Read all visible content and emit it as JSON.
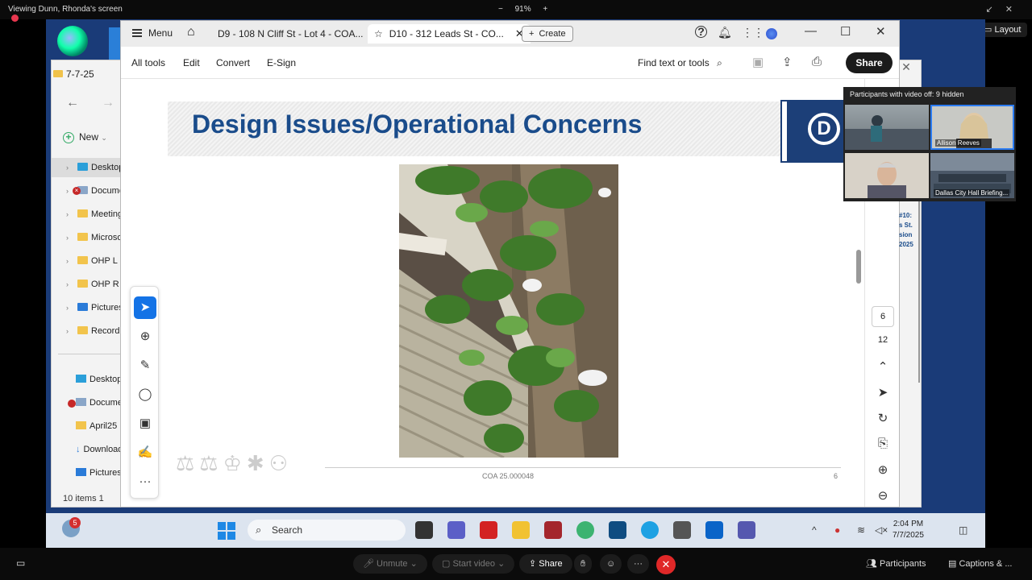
{
  "zoom": {
    "viewing": "Viewing Dunn, Rhonda's screen",
    "zoom_level": "91%",
    "minus": "−",
    "plus": "+",
    "layout": "Layout",
    "participants_label": "Participants with video off: 9 hidden",
    "tiles": [
      {
        "name": ""
      },
      {
        "name": "Allison Reeves"
      },
      {
        "name": ""
      },
      {
        "name": "Dallas City Hall    Briefing..."
      }
    ],
    "bottom": {
      "unmute": "Unmute",
      "start_video": "Start video",
      "share": "Share",
      "participants": "Participants",
      "captions": "Captions & ..."
    }
  },
  "explorer": {
    "tab_title": "7-7-25",
    "new_label": "New",
    "tree": [
      "Desktop",
      "Documents",
      "Meetings",
      "Microsoft",
      "OHP L",
      "OHP R",
      "Pictures",
      "Recordings"
    ],
    "quick": [
      "Desktop",
      "Documents",
      "April25",
      "Downloads",
      "Pictures"
    ],
    "status": "10 items    1"
  },
  "acrobat": {
    "menu": "Menu",
    "tabs": [
      {
        "label": "D9 - 108 N Cliff St - Lot 4 - COA..."
      },
      {
        "label": "D10 - 312 Leads St - CO..."
      }
    ],
    "create": "Create",
    "toolbar": {
      "all_tools": "All tools",
      "edit": "Edit",
      "convert": "Convert",
      "esign": "E-Sign",
      "find": "Find text or tools",
      "share": "Share"
    },
    "page": {
      "title": "Design Issues/Operational Concerns",
      "footer": "COA 25.000048",
      "page_number": "6"
    },
    "nav": {
      "current_page": "6",
      "total_pages": "12"
    },
    "behind_text": [
      "#10:",
      "s St.",
      "sion",
      "2025"
    ]
  },
  "taskbar": {
    "badge": "5",
    "search": "Search",
    "time": "2:04 PM",
    "date": "7/7/2025"
  }
}
